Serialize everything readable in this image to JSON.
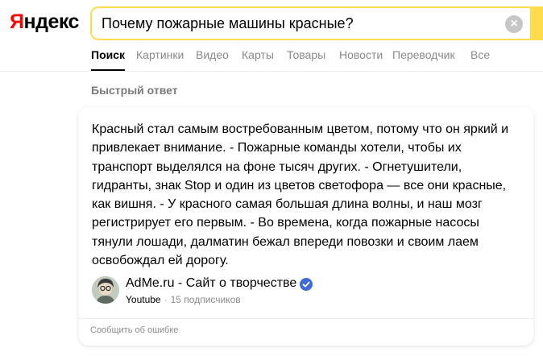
{
  "logo": {
    "first_letter": "Я",
    "rest": "ндекс"
  },
  "search": {
    "query": "Почему пожарные машины красные?",
    "clear_icon": "close-icon"
  },
  "tabs": [
    {
      "label": "Поиск",
      "active": true
    },
    {
      "label": "Картинки"
    },
    {
      "label": "Видео"
    },
    {
      "label": "Карты"
    },
    {
      "label": "Товары"
    },
    {
      "label": "Новости"
    },
    {
      "label": "Переводчик"
    },
    {
      "label": "Все"
    }
  ],
  "quick_answer": {
    "section_title": "Быстрый ответ",
    "text": "Красный стал самым востребованным цветом, потому что он яркий и привлекает внимание. - Пожарные команды хотели, чтобы их транспорт выделялся на фоне тысяч других. - Огнетушители, гидранты, знак Stop и один из цветов светофора — все они красные, как вишня. - У красного самая большая длина волны, и наш мозг регистрирует его первым. - Во времена, когда пожарные насосы тянули лошади, далматин бежал впереди повозки и своим лаем освобождал ей дорогу.",
    "source": {
      "name": "AdMe.ru - Сайт о творчестве",
      "platform": "Youtube",
      "separator": "·",
      "subscribers": "15 подписчиков",
      "verified_color": "#3f6ad8"
    },
    "report_label": "Сообщить об ошибке"
  },
  "colors": {
    "accent": "#ffdb4d",
    "logo_red": "#ff0000"
  }
}
